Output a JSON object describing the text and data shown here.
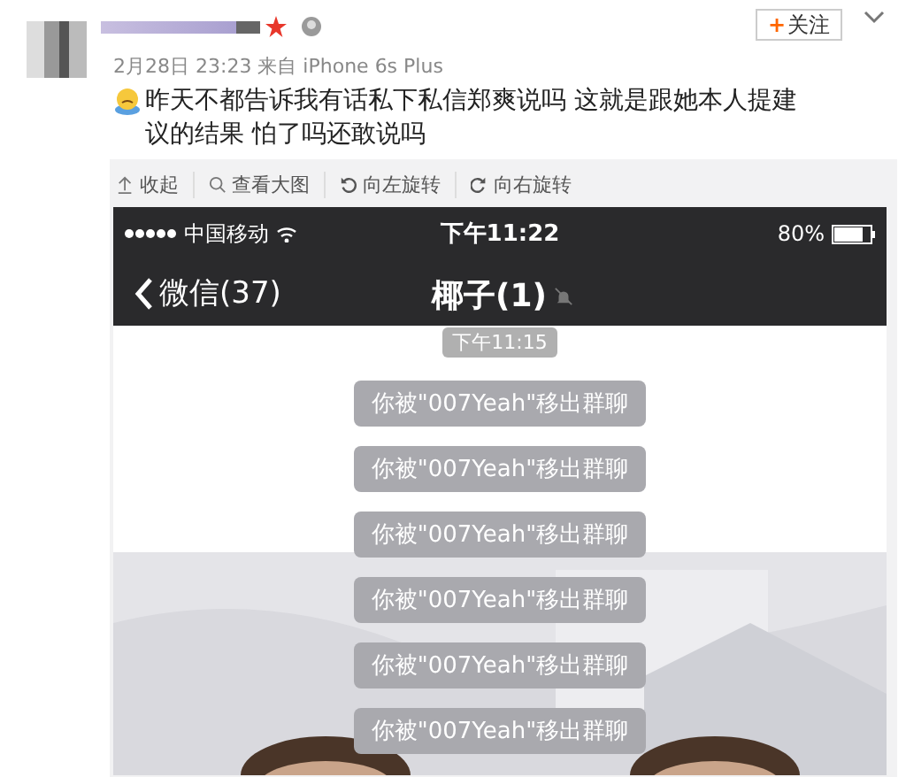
{
  "post": {
    "date": "2月28日 23:23",
    "source": "来自 iPhone 6s Plus",
    "follow": {
      "plus": "+",
      "label": "关注"
    },
    "text": "昨天不都告诉我有话私下私信郑爽说吗 这就是跟她本人提建议的结果 怕了吗还敢说吗"
  },
  "toolbar": [
    {
      "kind": "collapse",
      "label": "收起"
    },
    {
      "kind": "zoom",
      "label": "查看大图"
    },
    {
      "kind": "rotate-left",
      "label": "向左旋转"
    },
    {
      "kind": "rotate-right",
      "label": "向右旋转"
    }
  ],
  "phone": {
    "carrier": "中国移动",
    "time": "下午11:22",
    "battery_text": "80%",
    "level": 0.8,
    "back_label": "微信(37)",
    "chat_title": "椰子(1)",
    "muted": true,
    "timestamp": "下午11:15",
    "messages": [
      "你被\"007Yeah\"移出群聊",
      "你被\"007Yeah\"移出群聊",
      "你被\"007Yeah\"移出群聊",
      "你被\"007Yeah\"移出群聊",
      "你被\"007Yeah\"移出群聊",
      "你被\"007Yeah\"移出群聊"
    ]
  }
}
